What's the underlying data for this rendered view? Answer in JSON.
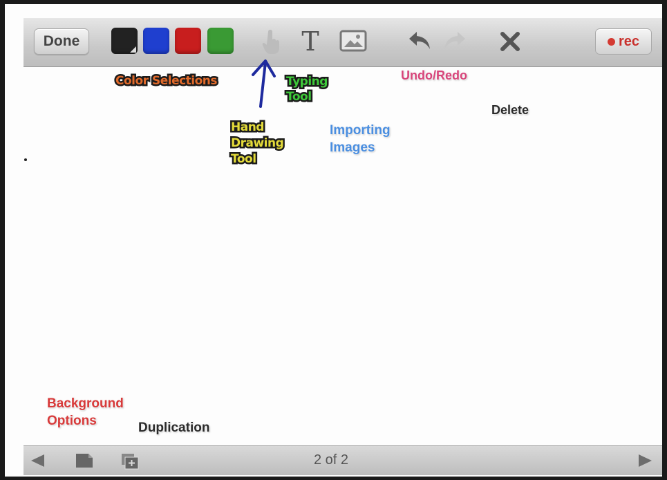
{
  "toolbar": {
    "done_label": "Done",
    "colors": [
      "#222222",
      "#1f3fcf",
      "#c81e1e",
      "#3a9a34"
    ],
    "rec_label": "rec"
  },
  "footer": {
    "page_label": "2 of 2"
  },
  "annotations": {
    "color_selections": "Color Selections",
    "typing_tool": [
      "Typing",
      "Tool"
    ],
    "hand_drawing_tool": [
      "Hand",
      "Drawing",
      "Tool"
    ],
    "importing_images": [
      "Importing",
      "Images"
    ],
    "undo_redo": "Undo/Redo",
    "delete": "Delete",
    "background_options": [
      "Background",
      "Options"
    ],
    "duplication": "Duplication"
  },
  "icons": [
    "hand-pointer-icon",
    "text-tool-icon",
    "image-icon",
    "undo-icon",
    "redo-icon",
    "close-icon",
    "record-dot-icon",
    "prev-page-icon",
    "background-page-icon",
    "duplicate-page-icon",
    "next-page-icon"
  ]
}
